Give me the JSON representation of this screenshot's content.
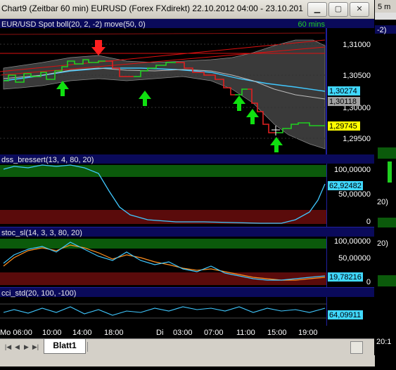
{
  "window": {
    "title": "Chart9 (Zeitbar 60 min)  EURUSD (Forex FXdirekt) 22.10.2012 04:00 - 23.10.201",
    "minimize_glyph": "▁",
    "maximize_glyph": "▢",
    "close_glyph": "✕"
  },
  "price_panel": {
    "title": "EUR/USD Spot  boll(20, 2, -2)  move(50, 0)",
    "interval": "60 mins",
    "y_ticks": [
      "1,31000",
      "1,30500",
      "1,30000",
      "1,29500"
    ],
    "boxes": {
      "move": "1,30274",
      "boll_mid": "1,30118",
      "last": "1,29745"
    }
  },
  "dss_panel": {
    "title": "dss_bressert(13, 4, 80, 20)",
    "y_ticks": [
      "100,00000",
      "50,00000",
      "0"
    ],
    "value": "62,92482"
  },
  "stoc_panel": {
    "title": "stoc_sl(14, 3, 3, 80, 20)",
    "y_ticks": [
      "100,00000",
      "50,00000",
      "0"
    ],
    "value": "19,78216"
  },
  "cci_panel": {
    "title": "cci_std(20, 100, -100)",
    "value": "64,09911"
  },
  "time_axis": [
    "Mo 06:00",
    "10:00",
    "14:00",
    "18:00",
    "Di",
    "03:00",
    "07:00",
    "11:00",
    "15:00",
    "19:00"
  ],
  "sheet_tab": "Blatt1",
  "sheet_nav": [
    "|◀",
    "◀",
    "▶",
    "▶|"
  ],
  "right_panel": {
    "top_label": "5 m",
    "label_2": "-2)",
    "label_3": "20)",
    "label_4": "20)",
    "label_5": "20:1"
  },
  "chart_data": [
    {
      "type": "line",
      "title": "EUR/USD Spot boll(20, 2, -2) move(50, 0)",
      "ylim": [
        1.2925,
        1.3125
      ],
      "x": [
        "Mo 06:00",
        "10:00",
        "14:00",
        "18:00",
        "Di",
        "03:00",
        "07:00",
        "11:00",
        "15:00",
        "19:00"
      ],
      "series": [
        {
          "name": "EUR/USD Spot",
          "values": [
            1.305,
            1.3054,
            1.3063,
            1.305,
            1.3053,
            1.3056,
            1.305,
            1.3024,
            1.2975,
            1.2974
          ]
        },
        {
          "name": "move(50, 0)",
          "values": [
            1.3052,
            1.3055,
            1.3058,
            1.306,
            1.306,
            1.3058,
            1.3053,
            1.3042,
            1.303,
            1.3027
          ]
        },
        {
          "name": "boll upper",
          "values": [
            1.308,
            1.3082,
            1.3085,
            1.3075,
            1.307,
            1.3072,
            1.3085,
            1.31,
            1.31,
            1.307
          ]
        },
        {
          "name": "boll lower",
          "values": [
            1.304,
            1.3038,
            1.304,
            1.3035,
            1.304,
            1.304,
            1.302,
            1.2995,
            1.2955,
            1.294
          ]
        }
      ]
    },
    {
      "type": "line",
      "title": "dss_bressert(13, 4, 80, 20)",
      "ylim": [
        0,
        100
      ],
      "series": [
        {
          "name": "dss",
          "values": [
            93,
            95,
            93,
            60,
            25,
            15,
            12,
            10,
            8,
            9,
            10,
            35,
            63
          ]
        }
      ]
    },
    {
      "type": "line",
      "title": "stoc_sl(14, 3, 3, 80, 20)",
      "ylim": [
        0,
        100
      ],
      "series": [
        {
          "name": "%K",
          "values": [
            40,
            65,
            90,
            80,
            50,
            30,
            45,
            35,
            25,
            15,
            10,
            8,
            12,
            20
          ]
        },
        {
          "name": "%D",
          "values": [
            45,
            60,
            88,
            85,
            60,
            35,
            42,
            38,
            28,
            18,
            12,
            10,
            10,
            18
          ]
        }
      ]
    },
    {
      "type": "line",
      "title": "cci_std(20, 100, -100)",
      "series": [
        {
          "name": "cci",
          "values": [
            0,
            -20,
            10,
            -30,
            -10,
            -40,
            -20,
            10,
            30,
            40,
            20,
            50,
            64
          ]
        }
      ]
    }
  ]
}
